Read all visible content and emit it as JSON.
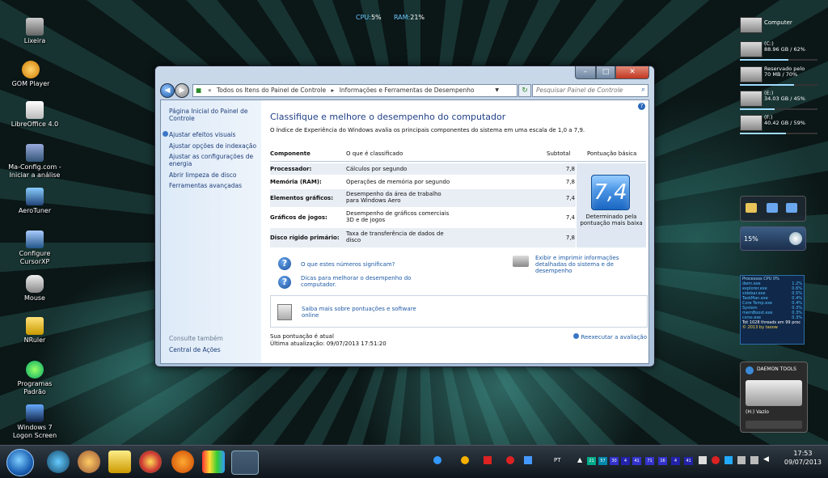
{
  "desktop": {
    "icons": [
      {
        "label": "Lixeira"
      },
      {
        "label": "GOM Player"
      },
      {
        "label": "LibreOffice 4.0"
      },
      {
        "label": "Ma-Config.com - Iniciar a análise"
      },
      {
        "label": "AeroTuner"
      },
      {
        "label": "Configure CursorXP"
      },
      {
        "label": "Mouse"
      },
      {
        "label": "NRuler"
      },
      {
        "label": "Programas Padrão"
      },
      {
        "label": "Windows 7 Logon Screen"
      }
    ],
    "meter": {
      "cpu_label": "CPU:",
      "cpu_value": "5%",
      "ram_label": "RAM:",
      "ram_value": "21%"
    }
  },
  "gadgets": {
    "computer_title": "Computer",
    "drives": [
      {
        "name": "(C:)",
        "info": "88.96 GB / 62%",
        "used_fraction": 0.62
      },
      {
        "name": "Reservado pelo",
        "info": "70 MB / 70%",
        "used_fraction": 0.7
      },
      {
        "name": "(E:)",
        "info": "34.03 GB / 45%",
        "used_fraction": 0.45
      },
      {
        "name": "(F:)",
        "info": "40.42 GB / 59%",
        "used_fraction": 0.59
      }
    ],
    "cpu_percent": "15%",
    "processes": {
      "title": "Processos CPU 0%",
      "rows": [
        {
          "name": "dwm.exe",
          "value": "1.2%"
        },
        {
          "name": "explorer.exe",
          "value": "0.6%"
        },
        {
          "name": "sidebar.exe",
          "value": "0.5%"
        },
        {
          "name": "TaskMan.exe",
          "value": "0.4%"
        },
        {
          "name": "Core Temp.exe",
          "value": "0.4%"
        },
        {
          "name": "System",
          "value": "0.3%"
        },
        {
          "name": "memBoost.exe",
          "value": "0.3%"
        },
        {
          "name": "csrss.exe",
          "value": "0.3%"
        }
      ],
      "footer": "Tot 1028 threads em 99 proc",
      "credit": "© 2013 by taoow"
    },
    "daemon": {
      "title": "DAEMON TOOLS",
      "drive": "(H:) Vazio"
    }
  },
  "window": {
    "address": {
      "crumbs": [
        "«",
        "Todos os Itens do Painel de Controle",
        "▸",
        "Informações e Ferramentas de Desempenho"
      ]
    },
    "search_placeholder": "Pesquisar Painel de Controle",
    "left_links": [
      "Página Inicial do Painel de Controle",
      "Ajustar efeitos visuais",
      "Ajustar opções de indexação",
      "Ajustar as configurações de energia",
      "Abrir limpeza de disco",
      "Ferramentas avançadas"
    ],
    "see_also": "Consulte também",
    "see_also_links": [
      "Central de Ações"
    ],
    "title": "Classifique e melhore o desempenho do computador",
    "description": "O Índice de Experiência do Windows avalia os principais componentes do sistema em uma escala de 1,0 a 7,9.",
    "table": {
      "headers": [
        "Componente",
        "O que é classificado",
        "Subtotal",
        "Pontuação básica"
      ],
      "rows": [
        {
          "component": "Processador:",
          "rated": "Cálculos por segundo",
          "subtotal": "7,8"
        },
        {
          "component": "Memória (RAM):",
          "rated": "Operações de memória por segundo",
          "subtotal": "7,8"
        },
        {
          "component": "Elementos gráficos:",
          "rated": "Desempenho da área de trabalho para Windows Aero",
          "subtotal": "7,4"
        },
        {
          "component": "Gráficos de jogos:",
          "rated": "Desempenho de gráficos comerciais 3D e de jogos",
          "subtotal": "7,4"
        },
        {
          "component": "Disco rígido primário:",
          "rated": "Taxa de transferência de dados de disco",
          "subtotal": "7,8"
        }
      ],
      "base_score": "7,4",
      "base_score_caption": "Determinado pela pontuação mais baixa"
    },
    "links": {
      "what_mean": "O que estes números significam?",
      "print": "Exibir e imprimir informações detalhadas do sistema e de desempenho",
      "tips": "Dicas para melhorar o desempenho do computador.",
      "learn": "Saiba mais sobre pontuações e software online"
    },
    "status": "Sua pontuação é atual",
    "last_update": "Última atualização: 09/07/2013 17:51:20",
    "rerun": "Reexecutar a avaliação"
  },
  "taskbar": {
    "tray_numbers": [
      "21",
      "57",
      "30",
      "4",
      "41",
      "71",
      "16",
      "4",
      "41"
    ],
    "tray_label": "PT",
    "time": "17:53",
    "date": "09/07/2013"
  },
  "colors": {
    "accent": "#1f3f86",
    "link": "#1d5aa5",
    "badge": "#1a66c2"
  }
}
